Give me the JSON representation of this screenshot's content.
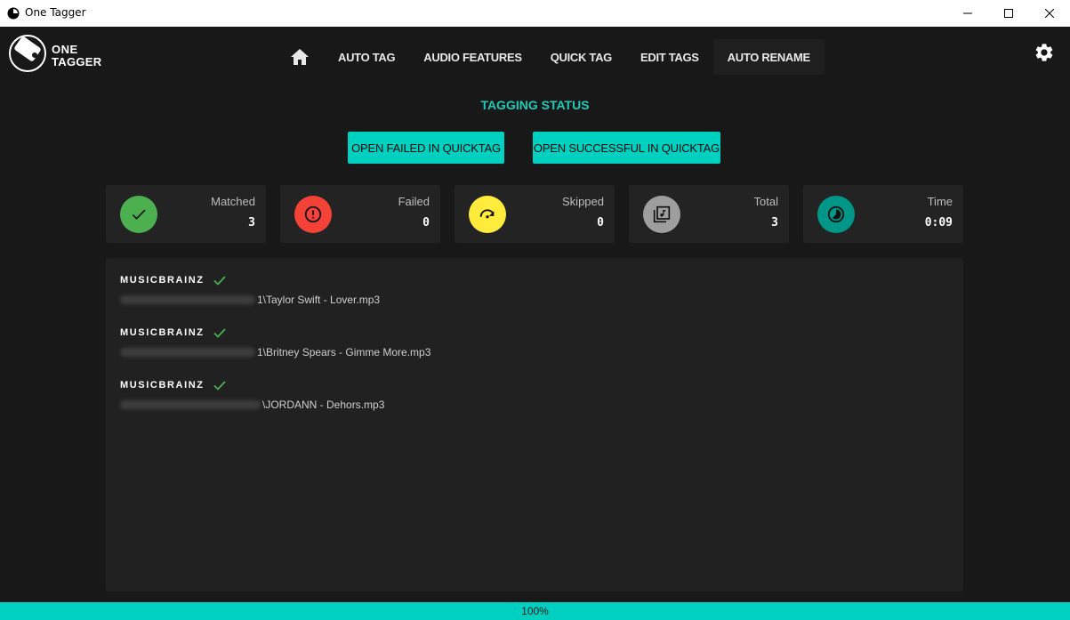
{
  "window": {
    "title": "One Tagger"
  },
  "logo": {
    "line1": "ONE",
    "line2": "TAGGER"
  },
  "nav": {
    "items": [
      {
        "label": "AUTO TAG"
      },
      {
        "label": "AUDIO FEATURES"
      },
      {
        "label": "QUICK TAG"
      },
      {
        "label": "EDIT TAGS"
      },
      {
        "label": "AUTO RENAME"
      }
    ]
  },
  "status": {
    "title": "TAGGING STATUS",
    "open_failed_label": "OPEN FAILED IN QUICKTAG",
    "open_success_label": "OPEN SUCCESSFUL IN QUICKTAG"
  },
  "stats": [
    {
      "label": "Matched",
      "value": "3",
      "color": "#4caf50",
      "icon": "check-icon"
    },
    {
      "label": "Failed",
      "value": "0",
      "color": "#f44336",
      "icon": "error-icon"
    },
    {
      "label": "Skipped",
      "value": "0",
      "color": "#ffeb3b",
      "icon": "skip-icon"
    },
    {
      "label": "Total",
      "value": "3",
      "color": "#9e9e9e",
      "icon": "library-music-icon"
    },
    {
      "label": "Time",
      "value": "0:09",
      "color": "#009688",
      "icon": "timelapse-icon"
    }
  ],
  "results": [
    {
      "source": "MUSICBRAINZ",
      "path_suffix": "1\\Taylor Swift - Lover.mp3"
    },
    {
      "source": "MUSICBRAINZ",
      "path_suffix": "1\\Britney Spears - Gimme More.mp3"
    },
    {
      "source": "MUSICBRAINZ",
      "path_suffix": "\\JORDANN - Dehors.mp3"
    }
  ],
  "progress": {
    "value": 1.0,
    "label": "100%"
  },
  "colors": {
    "accent": "#00d0bf",
    "background": "#181818",
    "panel": "#212121"
  }
}
